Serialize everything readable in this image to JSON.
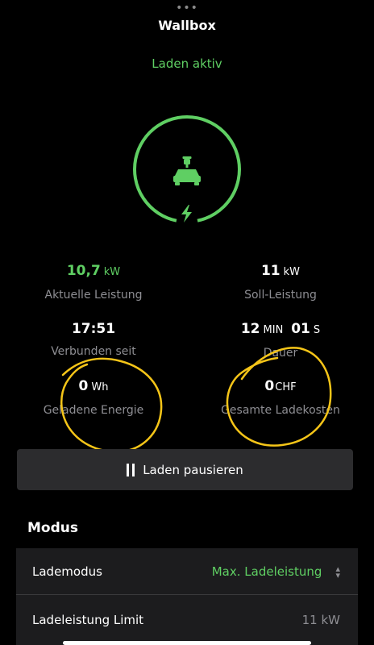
{
  "header": {
    "drag_handle": "•••",
    "title": "Wallbox"
  },
  "status": {
    "text": "Laden aktiv",
    "color": "#5fcf63"
  },
  "status_icon": {
    "icon": "car-charging-icon",
    "ring_icon": "lightning-bolt-icon"
  },
  "stats": {
    "current_power": {
      "value": "10,7",
      "unit": "kW",
      "label": "Aktuelle Leistung"
    },
    "target_power": {
      "value": "11",
      "unit": "kW",
      "label": "Soll-Leistung"
    },
    "connected_since": {
      "value": "17:51",
      "label": "Verbunden seit"
    },
    "duration": {
      "min_value": "12",
      "min_unit": "MIN",
      "sec_value": "01",
      "sec_unit": "S",
      "label": "Dauer"
    },
    "energy": {
      "value": "0",
      "unit": "Wh",
      "label": "Geladene Energie"
    },
    "cost": {
      "value": "0",
      "unit": "CHF",
      "label": "Gesamte Ladekosten"
    }
  },
  "actions": {
    "pause_label": "Laden pausieren",
    "pause_icon": "pause-icon"
  },
  "mode": {
    "section_title": "Modus",
    "charge_mode_label": "Lademodus",
    "charge_mode_value": "Max. Ladeleistung",
    "charge_limit_label": "Ladeleistung Limit",
    "charge_limit_value": "11 kW"
  },
  "colors": {
    "accent_green": "#5fcf63",
    "annotation_yellow": "#f5c518",
    "button_bg": "#2c2c2e",
    "panel_bg": "#1c1c1e"
  }
}
